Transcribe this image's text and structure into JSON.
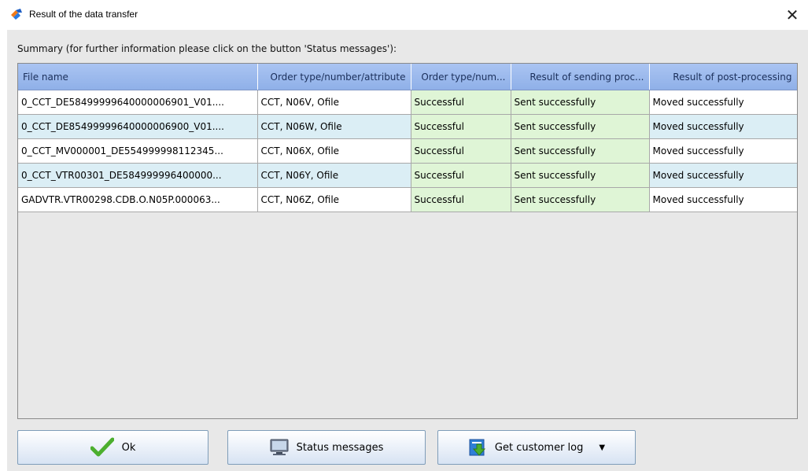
{
  "window": {
    "title": "Result of the data transfer",
    "close_glyph": "✕"
  },
  "summary_text": "Summary (for further information please click on the button 'Status messages'):",
  "table": {
    "columns": [
      "File name",
      "Order type/number/attribute",
      "Order type/num...",
      "Result of sending proc...",
      "Result of post-processing"
    ],
    "rows": [
      [
        "0_CCT_DE58499999640000006901_V01....",
        "CCT, N06V, Ofile",
        "Successful",
        "Sent successfully",
        "Moved successfully"
      ],
      [
        "0_CCT_DE85499999640000006900_V01....",
        "CCT, N06W, Ofile",
        "Successful",
        "Sent successfully",
        "Moved successfully"
      ],
      [
        "0_CCT_MV000001_DE554999998112345...",
        "CCT, N06X, Ofile",
        "Successful",
        "Sent successfully",
        "Moved successfully"
      ],
      [
        "0_CCT_VTR00301_DE584999996400000...",
        "CCT, N06Y, Ofile",
        "Successful",
        "Sent successfully",
        "Moved successfully"
      ],
      [
        "GADVTR.VTR00298.CDB.O.N05P.000063...",
        "CCT, N06Z, Ofile",
        "Successful",
        "Sent successfully",
        "Moved successfully"
      ]
    ]
  },
  "buttons": {
    "ok": "Ok",
    "status": "Status messages",
    "log": "Get customer log",
    "log_arrow": "▼"
  },
  "colors": {
    "header": "#9db9ee",
    "success_cell": "#dff5d6",
    "row_alt": "#dbeef5",
    "checkmark": "#4caf2e"
  },
  "icons": [
    "app-icon",
    "close-icon",
    "checkmark-icon",
    "monitor-icon",
    "customer-log-icon",
    "dropdown-arrow-icon"
  ]
}
